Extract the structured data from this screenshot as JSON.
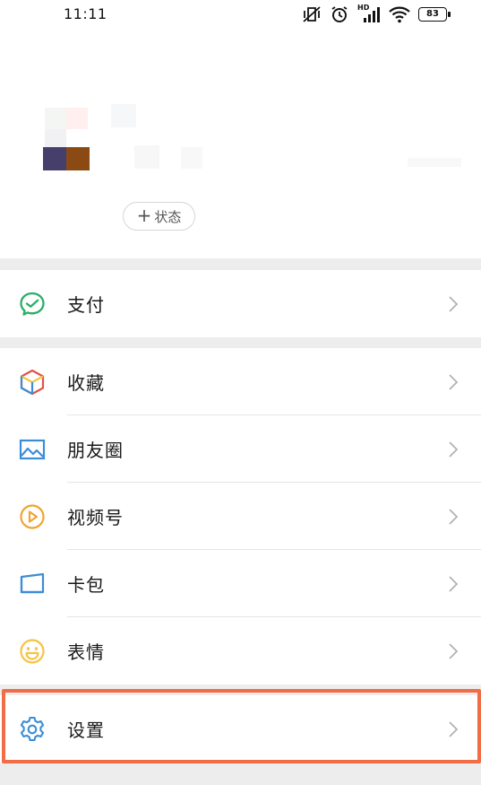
{
  "status_bar": {
    "time": "11:11",
    "battery": "83",
    "network_label": "HD"
  },
  "profile": {
    "status_button": {
      "plus": "+",
      "label": "状态"
    }
  },
  "menu": {
    "pay": {
      "label": "支付",
      "icon": "pay-icon"
    },
    "favorites": {
      "label": "收藏",
      "icon": "favorites-cube-icon"
    },
    "moments": {
      "label": "朋友圈",
      "icon": "moments-picture-icon"
    },
    "channels": {
      "label": "视频号",
      "icon": "channels-play-icon"
    },
    "cards": {
      "label": "卡包",
      "icon": "card-wallet-icon"
    },
    "stickers": {
      "label": "表情",
      "icon": "sticker-smile-icon"
    },
    "settings": {
      "label": "设置",
      "icon": "gear-icon"
    }
  },
  "colors": {
    "highlight": "#f26c45",
    "pay_green": "#2aae67",
    "moments_blue": "#3d8dd6",
    "channels_orange": "#f0a431",
    "stickers_yellow": "#f6c443",
    "settings_blue": "#3d8dd6"
  }
}
